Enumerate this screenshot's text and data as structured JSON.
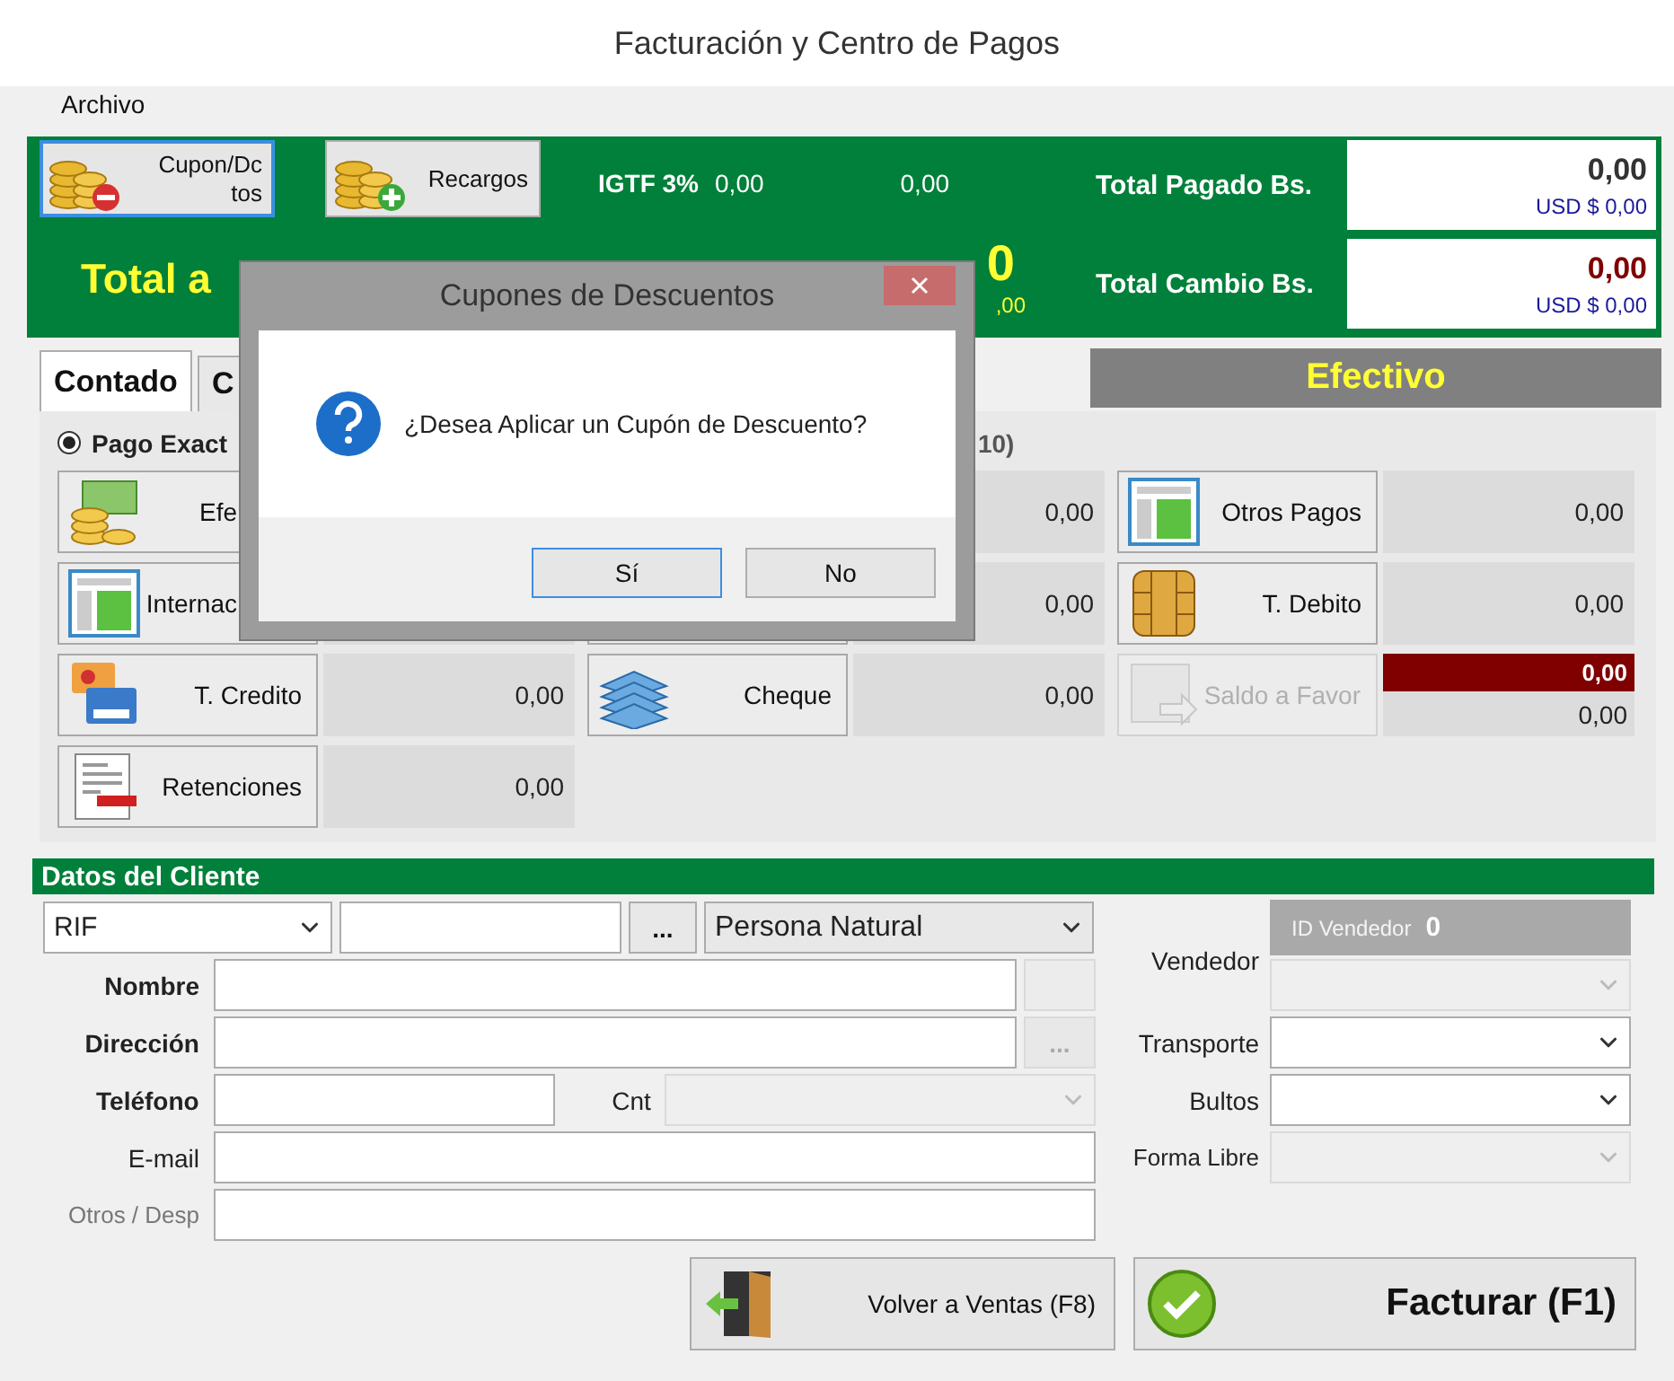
{
  "window": {
    "title": "Facturación y Centro de Pagos"
  },
  "menu": [
    {
      "label": "Archivo"
    }
  ],
  "summary": {
    "buttons": [
      {
        "kind": "coupon",
        "label": "Cupon/Dctos",
        "focused": true
      },
      {
        "kind": "surcharge",
        "label": "Recargos",
        "focused": false
      }
    ],
    "igtf_label": "IGTF 3%",
    "igtf_value": "0,00",
    "igtf_usd": "0,00",
    "total_label": "Total a",
    "total_value": "0",
    "total_usd": ",00",
    "totals": [
      {
        "label": "Total Pagado Bs.",
        "value": "0,00",
        "usd": "USD $ 0,00",
        "color": "#333333"
      },
      {
        "label": "Total Cambio Bs.",
        "value": "0,00",
        "usd": "USD $ 0,00",
        "color": "#800000"
      }
    ]
  },
  "tabs": [
    {
      "label": "Contado",
      "selected": true
    },
    {
      "label": "C",
      "selected": false
    }
  ],
  "method_banner": "Efectivo",
  "payment": {
    "options": [
      {
        "label": "Pago Exact",
        "selected": true
      }
    ],
    "note": "10)",
    "methods": [
      {
        "kind": "cash",
        "label": "Efe",
        "cut": true
      },
      {
        "kind": "hidden",
        "value": "0,00"
      },
      {
        "kind": "panel",
        "label": "Otros Pagos",
        "value": "0,00"
      },
      {
        "kind": "panel",
        "label": "Internac",
        "cut": true
      },
      {
        "kind": "hidden",
        "value": "0,00"
      },
      {
        "kind": "chip",
        "label": "T. Debito",
        "value": "0,00"
      },
      {
        "kind": "card",
        "label": "T. Credito",
        "value": "0,00"
      },
      {
        "kind": "cheque",
        "label": "Cheque",
        "value": "0,00"
      },
      {
        "kind": "balance",
        "label": "Saldo a Favor",
        "disabled": true,
        "value": "0,00",
        "sub_value": "0,00"
      },
      {
        "kind": "document",
        "label": "Retenciones",
        "value": "0,00"
      }
    ]
  },
  "client": {
    "title": "Datos del Cliente",
    "id_type": "RIF",
    "search_button": "...",
    "person_type": "Persona Natural",
    "fields": [
      {
        "label": "Nombre",
        "kind": "required",
        "extra": {
          "kind": "box"
        }
      },
      {
        "label": "Dirección",
        "kind": "required",
        "extra": {
          "kind": "button",
          "label": "..."
        }
      },
      {
        "label": "Teléfono",
        "kind": "required",
        "extra": {
          "kind": "count",
          "label": "Cnt"
        }
      },
      {
        "label": "E-mail",
        "kind": "normal"
      },
      {
        "label": "Otros / Desp",
        "kind": "muted"
      }
    ],
    "seller": {
      "id_label": "ID Vendedor",
      "id_value": "0",
      "label": "Vendedor",
      "disabled": true
    },
    "right_fields": [
      {
        "label": "Transporte",
        "disabled": false
      },
      {
        "label": "Bultos",
        "disabled": false
      },
      {
        "label": "Forma Libre",
        "disabled": true
      }
    ]
  },
  "actions": [
    {
      "kind": "back",
      "label": "Volver a Ventas (F8)"
    },
    {
      "kind": "invoice",
      "label": "Facturar (F1)"
    }
  ],
  "dialog": {
    "title": "Cupones de Descuentos",
    "message": "¿Desea Aplicar un Cupón de Descuento?",
    "buttons": [
      {
        "label": "Sí",
        "selected": true
      },
      {
        "label": "No",
        "selected": false
      }
    ]
  }
}
